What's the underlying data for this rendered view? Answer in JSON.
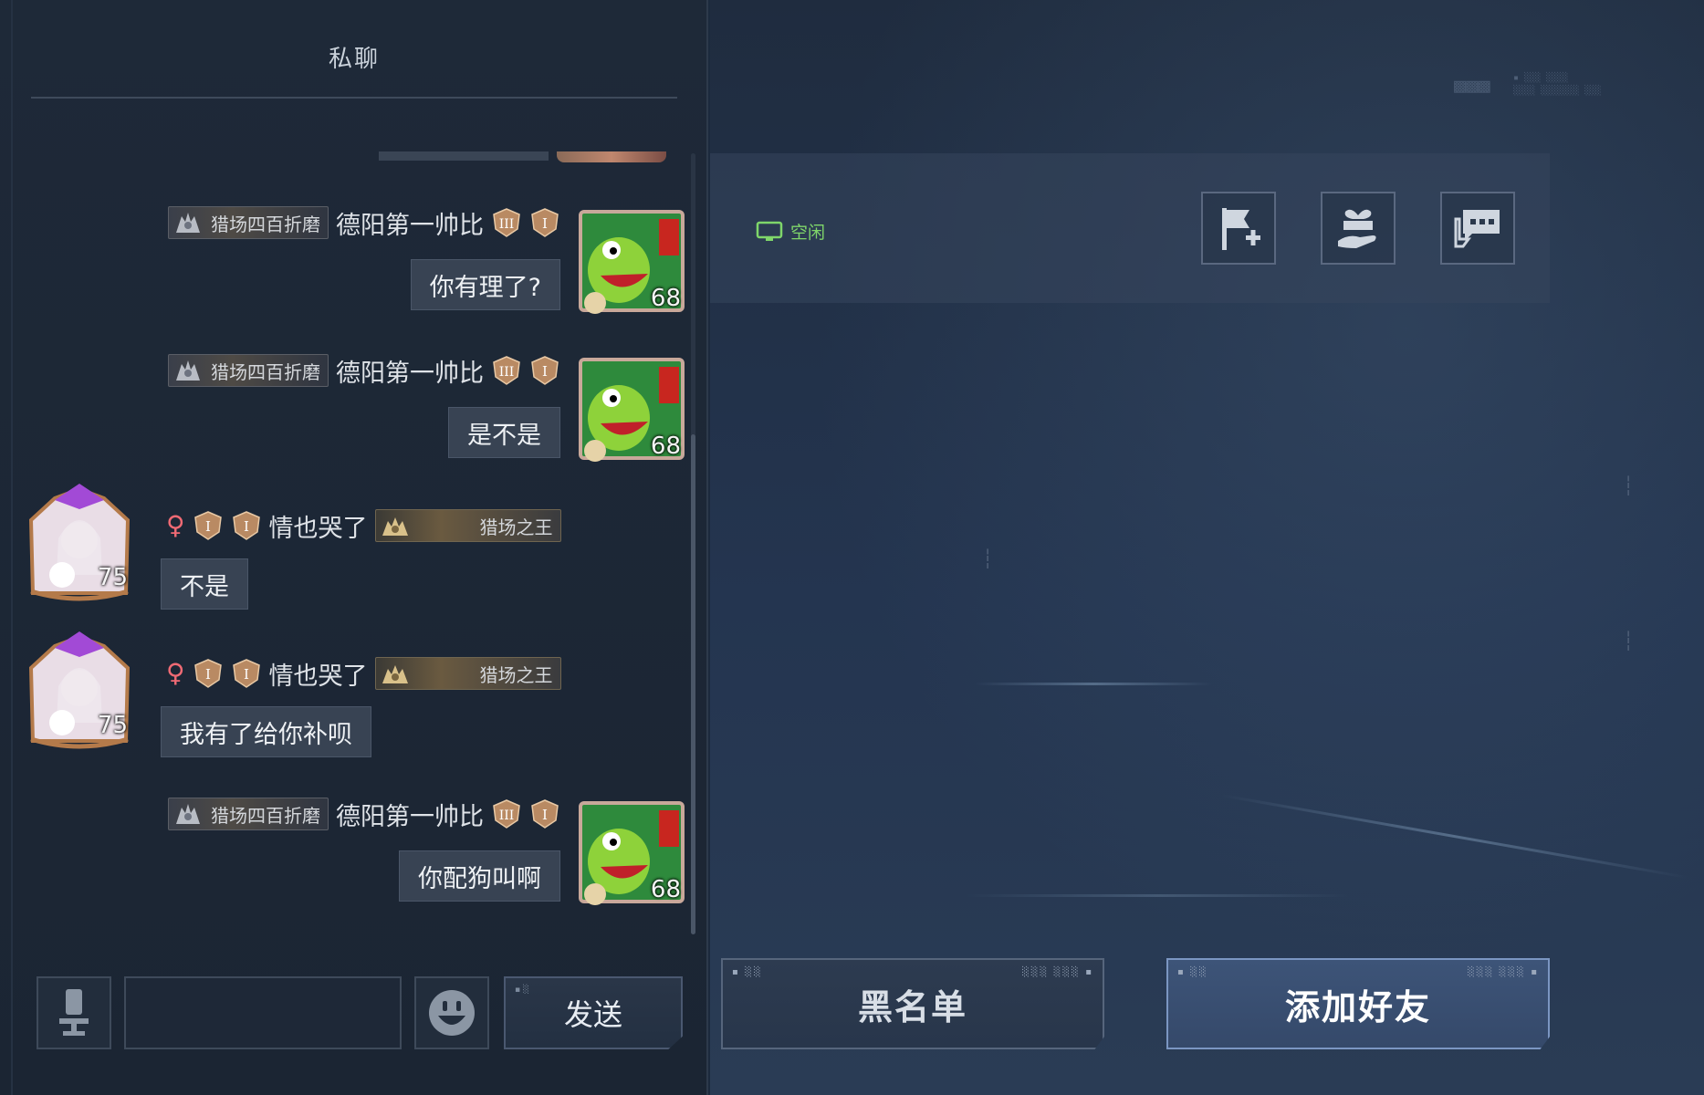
{
  "chat": {
    "title": "私聊",
    "messages": [
      {
        "side": "self",
        "title": "猎场四百折磨",
        "nickname": "德阳第一帅比",
        "text": "你有理了?",
        "level": "68"
      },
      {
        "side": "self",
        "title": "猎场四百折磨",
        "nickname": "德阳第一帅比",
        "text": "是不是",
        "level": "68"
      },
      {
        "side": "other",
        "gender": "♀",
        "nickname": "情也哭了",
        "title": "猎场之王",
        "text": "不是",
        "level": "75"
      },
      {
        "side": "other",
        "gender": "♀",
        "nickname": "情也哭了",
        "title": "猎场之王",
        "text": "我有了给你补呗",
        "level": "75"
      },
      {
        "side": "self",
        "title": "猎场四百折磨",
        "nickname": "德阳第一帅比",
        "text": "你配狗叫啊",
        "level": "68"
      }
    ]
  },
  "input": {
    "placeholder": "",
    "send_label": "发送",
    "voice_icon": "microphone-icon",
    "emoji_icon": "emoji-icon"
  },
  "profile": {
    "status_text": "空闲",
    "status_color": "#7fd66a",
    "actions": [
      {
        "name": "flag-add-icon"
      },
      {
        "name": "gift-icon"
      },
      {
        "name": "chat-bubble-icon"
      }
    ]
  },
  "buttons": {
    "blacklist_label": "黑名单",
    "add_friend_label": "添加好友"
  },
  "colors": {
    "panel_bg": "#1e2938",
    "bubble_bg": "#384353",
    "accent_button": "#3d5478",
    "female": "#ef6a74"
  }
}
